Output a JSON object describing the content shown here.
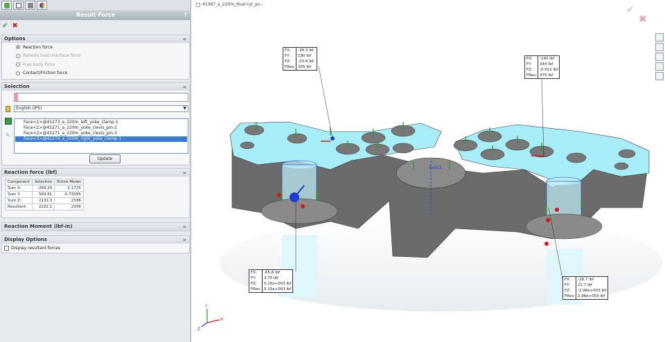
{
  "property_manager": {
    "title": "Result Force",
    "help": "?",
    "ok_glyph": "✔",
    "cancel_glyph": "✖",
    "options": {
      "header": "Options",
      "radios": [
        {
          "label": "Reaction force",
          "selected": true,
          "enabled": true
        },
        {
          "label": "Remote load interface force",
          "selected": false,
          "enabled": false
        },
        {
          "label": "Free body force",
          "selected": false,
          "enabled": false
        },
        {
          "label": "Contact/Friction force",
          "selected": false,
          "enabled": true
        }
      ]
    },
    "selection": {
      "header": "Selection",
      "units": "English (IPS)",
      "faces": [
        "Face<1>@41273_a_220m_left_yoke_clamp-1",
        "Face<2>@41271_a_220m_yoke_clevis_pin-2",
        "Face<2>@41271_a_220m_yoke_clevis_pin-3",
        "Face<3>@41274_a_220m_right_yoke_clamp-1"
      ],
      "selected_face_index": 3,
      "update_label": "Update"
    },
    "reaction_force": {
      "header": "Reaction force (lbf)",
      "columns": [
        "Component",
        "Selection",
        "Entire Model"
      ],
      "rows": [
        [
          "Sum X:",
          "-269.24",
          "-1.1725"
        ],
        [
          "Sum Y:",
          "569.61",
          "-0.73095"
        ],
        [
          "Sum Z:",
          "2131.3",
          "2336"
        ],
        [
          "Resultant:",
          "2222.1",
          "2336"
        ]
      ]
    },
    "reaction_moment": {
      "header": "Reaction Moment (lbf-in)"
    },
    "display_options": {
      "header": "Display Options",
      "checkbox_label": "Display resultant forces",
      "checked": false
    }
  },
  "graphics": {
    "document_title": "41367_a_220m_dual-cyl_yo...",
    "callouts": [
      {
        "rows": [
          [
            "FX:",
            "-38.3 lbf"
          ],
          [
            "FY:",
            "190 lbf"
          ],
          [
            "FZ:",
            "-20.8 lbf"
          ],
          [
            "FRes:",
            "205 lbf"
          ]
        ]
      },
      {
        "rows": [
          [
            "FX:",
            "-140 lbf"
          ],
          [
            "FY:",
            "344 lbf"
          ],
          [
            "FZ:",
            "-0.511 lbf"
          ],
          [
            "FRes:",
            "375 lbf"
          ]
        ]
      },
      {
        "rows": [
          [
            "FX:",
            "-65.8 lbf"
          ],
          [
            "FY:",
            "3.75 lbf"
          ],
          [
            "FZ:",
            "5.15e+003 lbf"
          ],
          [
            "FRes:",
            "5.15e+003 lbf"
          ]
        ]
      },
      {
        "rows": [
          [
            "FX:",
            "-28.7 lbf"
          ],
          [
            "FY:",
            "22.7 lbf"
          ],
          [
            "FZ:",
            "-2.96e+003 lbf"
          ],
          [
            "FRes:",
            "2.96e+003 lbf"
          ]
        ]
      }
    ],
    "axis_label": "Axis1",
    "triad_labels": [
      "X",
      "Y",
      "Z"
    ],
    "colors": {
      "part_top": "#a8eef9",
      "part_side": "#6b6b6b",
      "arrow_green": "#1f9e2c",
      "arrow_red": "#d01818",
      "arrow_blue": "#1a3bd6"
    }
  }
}
